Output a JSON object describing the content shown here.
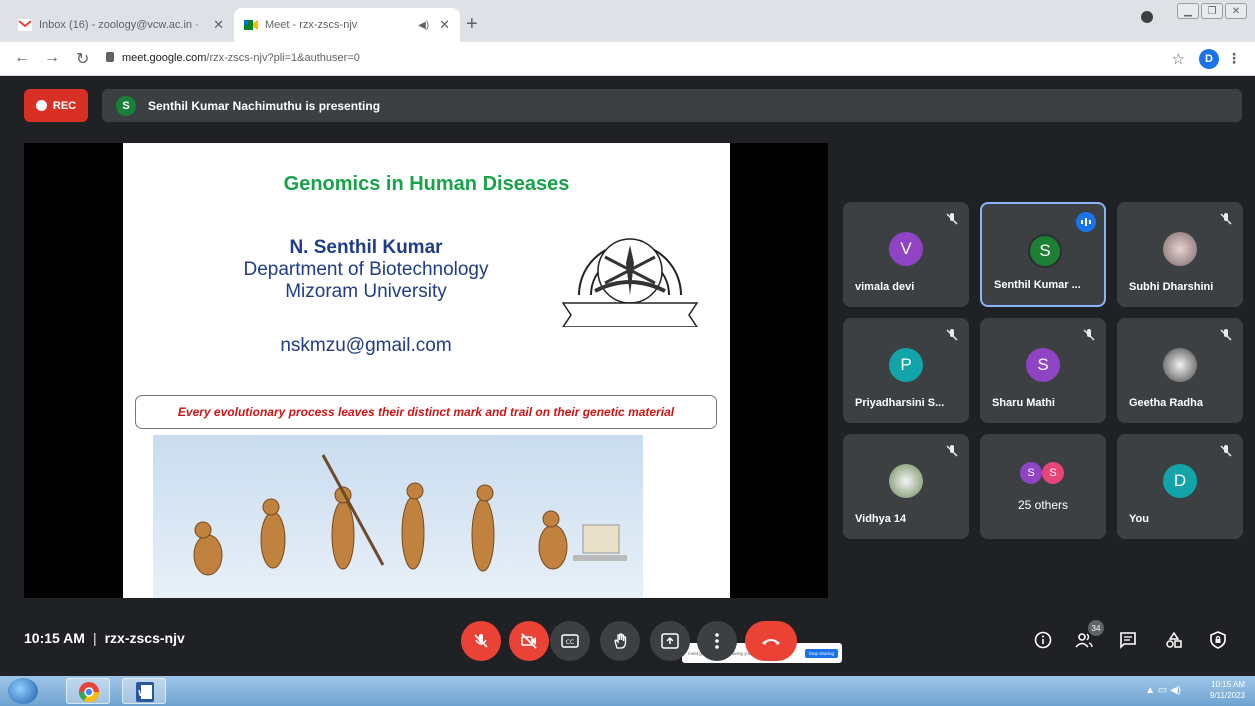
{
  "browser": {
    "tabs": [
      {
        "title": "Inbox (16) - zoology@vcw.ac.in ·",
        "active": false,
        "icon": "gmail-icon"
      },
      {
        "title": "Meet - rzx-zscs-njv",
        "active": true,
        "icon": "meet-icon"
      }
    ],
    "new_tab": "+",
    "close_glyph": "✕",
    "url_host": "meet.google.com",
    "url_path": "/rzx-zscs-njv?pli=1&authuser=0",
    "profile_initial": "D"
  },
  "meet": {
    "rec_label": "REC",
    "presenter_initial": "S",
    "presenting_text": "Senthil Kumar Nachimuthu is presenting",
    "slide": {
      "title": "Genomics in Human Diseases",
      "author_name": "N. Senthil Kumar",
      "department": "Department of Biotechnology",
      "university": "Mizoram University",
      "email": "nskmzu@gmail.com",
      "logo_ribbon": "EST MIZORAM UNIVERSITY 2001",
      "quote": "Every evolutionary process leaves their distinct mark and trail on their genetic material"
    },
    "sharing_notice": {
      "text": "meet.google.com is sharing your screen.",
      "stop_label": "Stop sharing"
    },
    "participants": [
      {
        "name": "vimala devi",
        "initial": "V",
        "color": "#8e44c5",
        "muted": true
      },
      {
        "name": "Senthil Kumar ...",
        "initial": "S",
        "color": "#1e7e34",
        "speaking": true
      },
      {
        "name": "Subhi Dharshini",
        "initial": "",
        "color": "#5a5a5a",
        "muted": true,
        "photo": true
      },
      {
        "name": "Priyadharsini S...",
        "initial": "P",
        "color": "#12a4a8",
        "muted": true
      },
      {
        "name": "Sharu Mathi",
        "initial": "S",
        "color": "#8e44c5",
        "muted": true
      },
      {
        "name": "Geetha Radha",
        "initial": "",
        "color": "#5a5a5a",
        "muted": true,
        "photo": true
      },
      {
        "name": "Vidhya 14",
        "initial": "",
        "color": "#5a5a5a",
        "muted": true,
        "photo": true
      },
      {
        "name": "25 others",
        "initial": "S",
        "color": "#8e44c5",
        "others": true
      },
      {
        "name": "You",
        "initial": "D",
        "color": "#12a4a8",
        "muted": true
      }
    ],
    "time": "10:15 AM",
    "separator": "|",
    "meeting_code": "rzx-zscs-njv",
    "people_count": "34"
  },
  "taskbar": {
    "time": "10:15 AM",
    "date": "9/11/2023"
  },
  "colors": {
    "meet_bg": "#202124",
    "tile_bg": "#3c4043",
    "danger": "#ea4335",
    "accent": "#1a73e8",
    "slide_title": "#17a34a",
    "slide_text": "#1f3c88"
  }
}
